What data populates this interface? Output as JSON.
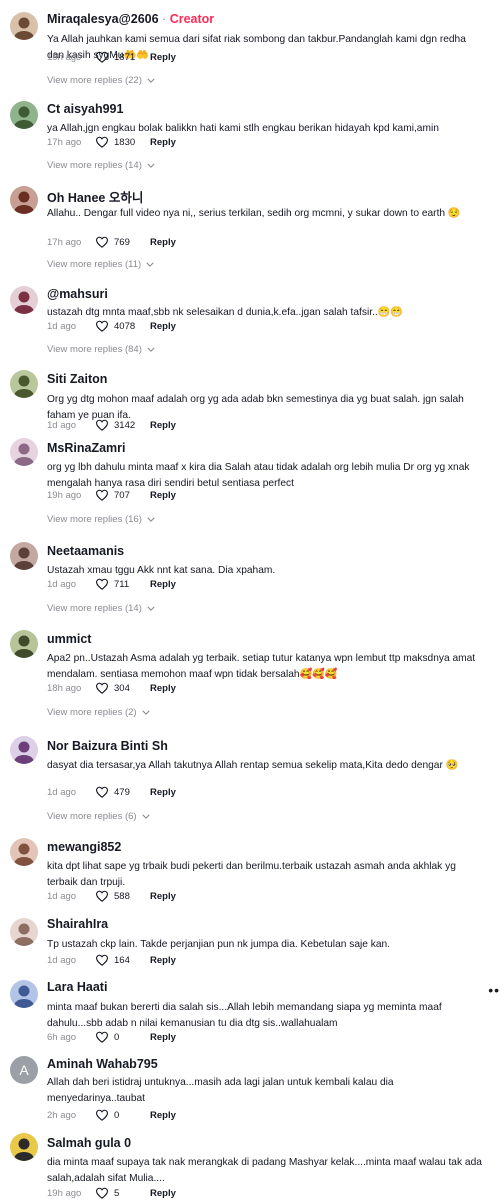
{
  "comments": [
    {
      "name": "Miraqalesya@2606",
      "creator_sep": " · ",
      "creator_label": "Creator",
      "text": "Ya Allah jauhkan kami semua dari sifat riak sombong dan takbur.Pandanglah kami dgn redha dan kasih sygMu🤲🤲",
      "time": "15h ago",
      "likes": "1871",
      "reply": "Reply",
      "more": "View more replies (22)"
    },
    {
      "name": "Ct aisyah991",
      "text": "ya Allah,jgn engkau bolak balikkn hati kami stlh engkau berikan hidayah kpd kami,amin",
      "time": "17h ago",
      "likes": "1830",
      "reply": "Reply",
      "more": "View more replies (14)"
    },
    {
      "name": "Oh Hanee 오하니",
      "text": "Allahu.. Dengar full video nya ni,, serius terkilan, sedih org mcmni, y sukar down to earth 😌",
      "time": "17h ago",
      "likes": "769",
      "reply": "Reply",
      "more": "View more replies (11)"
    },
    {
      "name": "@mahsuri",
      "text": "ustazah dtg mnta maaf,sbb nk selesaikan d dunia,k.efa..jgan salah tafsir..😁😁",
      "time": "1d ago",
      "likes": "4078",
      "reply": "Reply",
      "more": "View more replies (84)"
    },
    {
      "name": "Siti Zaiton",
      "text": "Org yg dtg mohon maaf adalah org yg ada adab bkn semestinya dia yg buat salah. jgn salah faham ye puan ifa.",
      "time": "1d ago",
      "likes": "3142",
      "reply": "Reply"
    },
    {
      "name": "MsRinaZamri",
      "text": "org yg lbh dahulu minta maaf x kira dia Salah atau tidak adalah org lebih mulia Dr org yg xnak mengalah hanya rasa diri sendiri betul sentiasa perfect",
      "time": "19h ago",
      "likes": "707",
      "reply": "Reply",
      "more": "View more replies (16)"
    },
    {
      "name": "Neetaamanis",
      "text": "Ustazah xmau tggu Akk nnt kat sana. Dia xpaham.",
      "time": "1d ago",
      "likes": "711",
      "reply": "Reply",
      "more": "View more replies (14)"
    },
    {
      "name": "ummict",
      "text": "Apa2 pn..Ustazah Asma adalah yg terbaik. setiap tutur katanya wpn lembut ttp maksdnya amat mendalam. sentiasa memohon maaf wpn tidak bersalah🥰🥰🥰",
      "time": "18h ago",
      "likes": "304",
      "reply": "Reply",
      "more": "View more replies (2)"
    },
    {
      "name": "Nor Baizura Binti Sh",
      "text": "dasyat dia tersasar,ya Allah takutnya Allah rentap semua sekelip mata,Kita dedo dengar 🥺",
      "time": "1d ago",
      "likes": "479",
      "reply": "Reply",
      "more": "View more replies (6)"
    },
    {
      "name": "mewangi852",
      "text": "kita dpt lihat sape yg trbaik budi pekerti dan berilmu.terbaik ustazah asmah anda akhlak yg terbaik dan trpuji.",
      "time": "1d ago",
      "likes": "588",
      "reply": "Reply"
    },
    {
      "name": "ShairahIra",
      "text": "Tp ustazah ckp lain. Takde perjanjian pun nk jumpa dia. Kebetulan saje kan.",
      "time": "1d ago",
      "likes": "164",
      "reply": "Reply"
    },
    {
      "name": "Lara Haati",
      "text": "minta maaf bukan bererti dia salah sis...Allah lebih memandang siapa yg meminta maaf dahulu...sbb adab n nilai kemanusian tu dia dtg sis..wallahualam",
      "time": "6h ago",
      "likes": "0",
      "reply": "Reply"
    },
    {
      "name": "Aminah Wahab795",
      "avatar_letter": "A",
      "text": "Allah dah beri istidraj untuknya...masih ada lagi jalan untuk kembali kalau dia menyedarinya..taubat",
      "time": "2h ago",
      "likes": "0",
      "reply": "Reply"
    },
    {
      "name": "Salmah gula 0",
      "text": "dia minta maaf supaya tak nak merangkak di padang Mashyar kelak....minta maaf walau tak ada salah,adalah sifat Mulia....",
      "time": "19h ago",
      "likes": "5",
      "reply": "Reply"
    }
  ],
  "more_options_glyph": "••"
}
